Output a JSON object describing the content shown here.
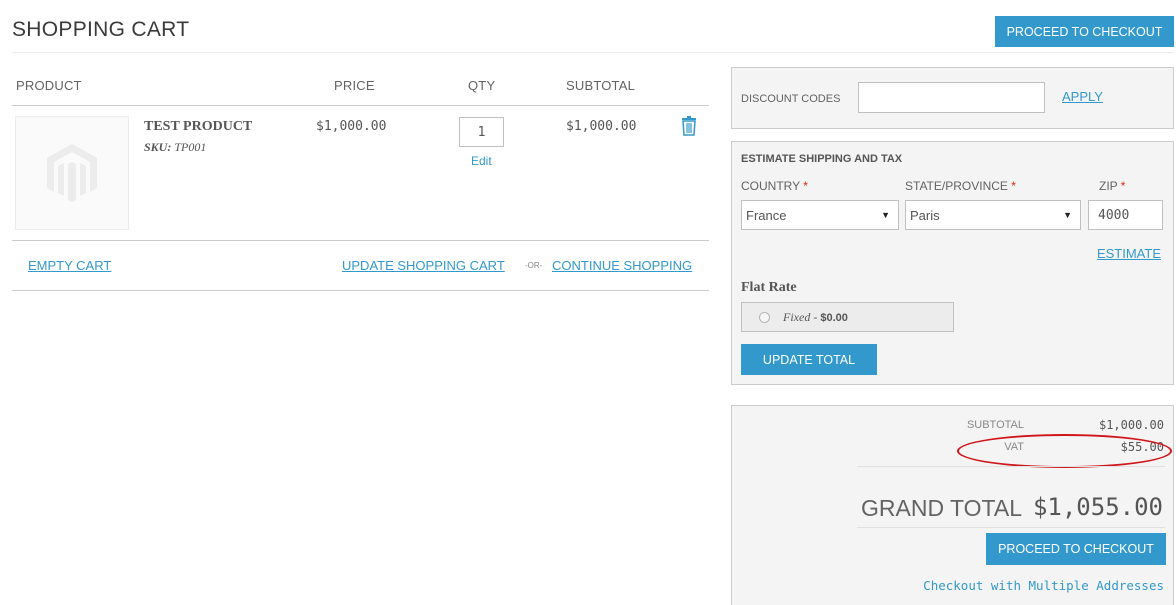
{
  "page": {
    "title": "SHOPPING CART",
    "checkout_button_top": "PROCEED TO CHECKOUT"
  },
  "cart": {
    "headers": {
      "product": "PRODUCT",
      "price": "PRICE",
      "qty": "QTY",
      "subtotal": "SUBTOTAL"
    },
    "items": [
      {
        "name": "TEST PRODUCT",
        "sku_label": "SKU:",
        "sku": "TP001",
        "price": "$1,000.00",
        "qty": "1",
        "edit_label": "Edit",
        "subtotal": "$1,000.00",
        "remove_icon": "trash-icon"
      }
    ],
    "actions": {
      "empty_cart": "EMPTY CART",
      "update_cart": "UPDATE SHOPPING CART",
      "or": "-OR-",
      "continue_shopping": "CONTINUE SHOPPING"
    }
  },
  "discount": {
    "label": "DISCOUNT CODES",
    "input_value": "",
    "apply": "APPLY"
  },
  "shipping": {
    "title": "ESTIMATE SHIPPING AND TAX",
    "country_label": "COUNTRY",
    "country_value": "France",
    "state_label": "STATE/PROVINCE",
    "state_value": "Paris",
    "zip_label": "ZIP",
    "zip_value": "4000",
    "required_mark": "*",
    "estimate": "ESTIMATE",
    "method_title": "Flat Rate",
    "method_option": "Fixed",
    "method_sep": " - ",
    "method_price": "$0.00",
    "update_total": "UPDATE TOTAL"
  },
  "totals": {
    "subtotal_label": "SUBTOTAL",
    "subtotal_value": "$1,000.00",
    "vat_label": "VAT",
    "vat_value": "$55.00",
    "grand_total_label": "GRAND TOTAL",
    "grand_total_value": "$1,055.00",
    "checkout_button": "PROCEED TO CHECKOUT",
    "multiple_addresses": "Checkout with Multiple Addresses"
  },
  "colors": {
    "accent": "#3399cc",
    "required": "#df280a",
    "annotation": "#d0161b"
  }
}
